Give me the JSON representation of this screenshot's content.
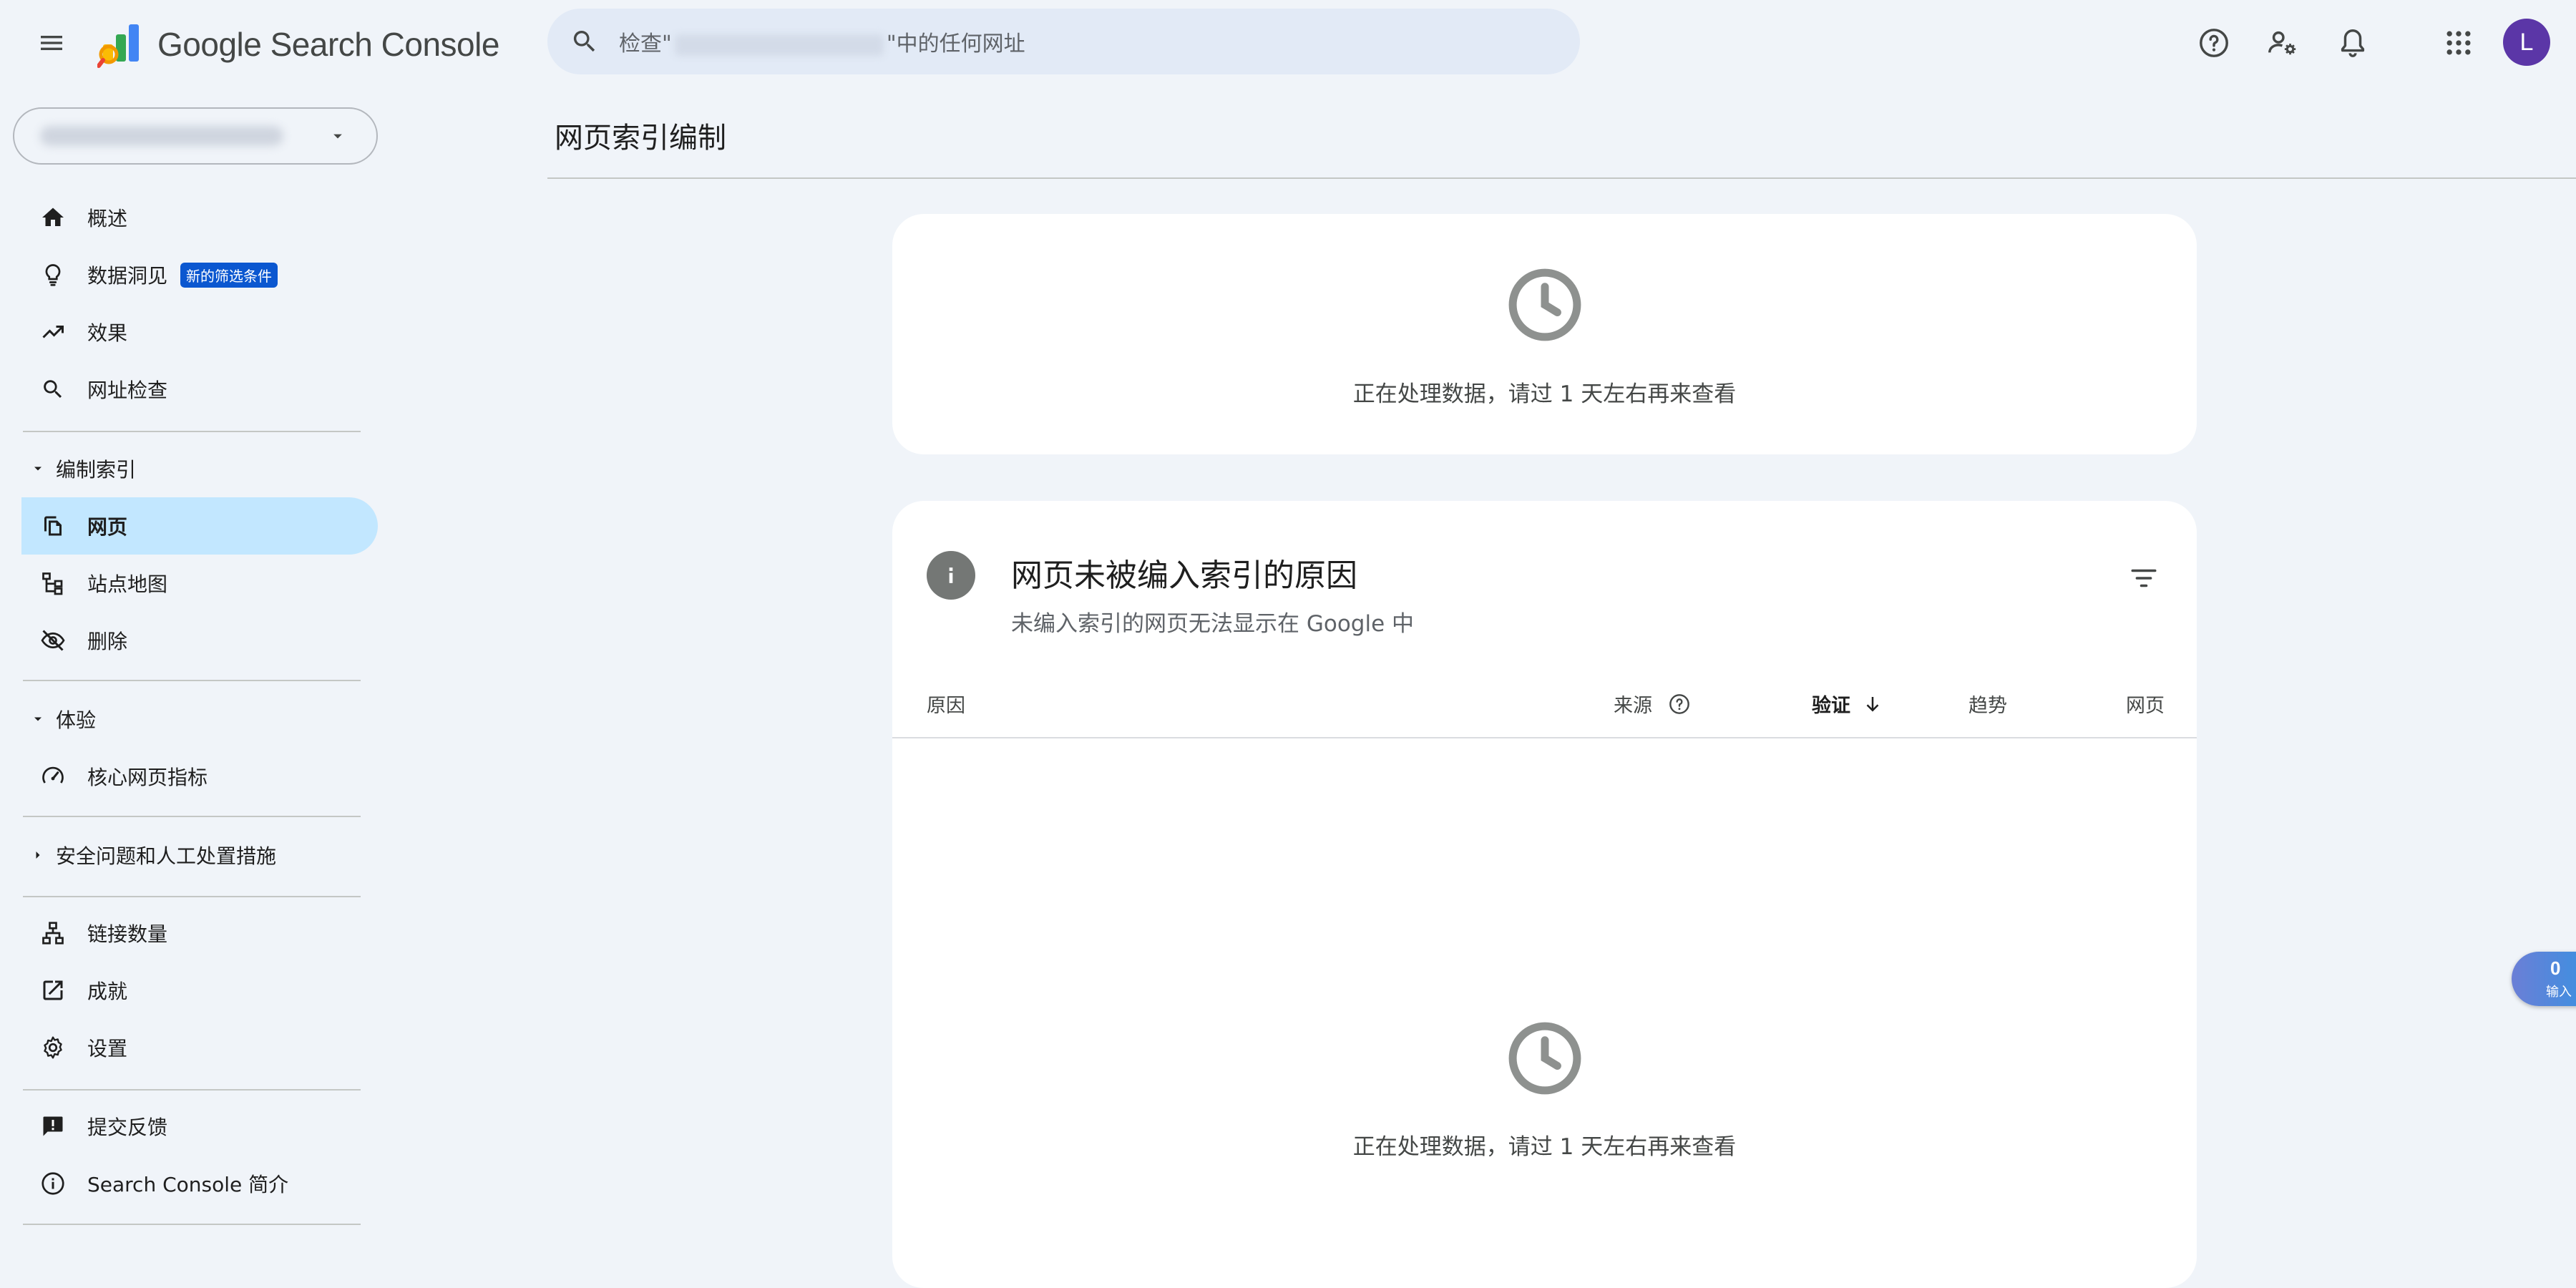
{
  "app": {
    "title": "Google Search Console",
    "brand_colors": {
      "blue": "#4285f4",
      "green": "#34a853",
      "yellow": "#fbbc04",
      "red": "#ea4335",
      "orange": "#f29900"
    }
  },
  "header": {
    "menu_icon": "menu-icon",
    "search": {
      "prefix": "检查",
      "suffix": "中的任何网址",
      "icon": "search-icon"
    },
    "icons": [
      "help-icon",
      "manage-accounts-icon",
      "notifications-icon",
      "apps-grid-icon"
    ],
    "avatar_letter": "L",
    "avatar_color": "#5b36a7"
  },
  "property_selector": {
    "icon": "dropdown-arrow-icon"
  },
  "sidebar": {
    "items_top": [
      {
        "label": "概述",
        "icon": "home-icon"
      },
      {
        "label": "数据洞见",
        "icon": "lightbulb-icon",
        "badge": "新的筛选条件"
      },
      {
        "label": "效果",
        "icon": "trending-up-icon"
      },
      {
        "label": "网址检查",
        "icon": "search-icon"
      }
    ],
    "index_section": {
      "label": "编制索引",
      "items": [
        {
          "label": "网页",
          "icon": "pages-icon",
          "active": true
        },
        {
          "label": "站点地图",
          "icon": "sitemap-icon"
        },
        {
          "label": "删除",
          "icon": "visibility-off-icon"
        }
      ]
    },
    "experience_section": {
      "label": "体验",
      "items": [
        {
          "label": "核心网页指标",
          "icon": "speed-icon"
        }
      ]
    },
    "security_section": {
      "label": "安全问题和人工处置措施"
    },
    "links_items": [
      {
        "label": "链接数量",
        "icon": "links-icon"
      },
      {
        "label": "成就",
        "icon": "open-in-new-icon"
      },
      {
        "label": "设置",
        "icon": "settings-icon"
      }
    ],
    "footer_items": [
      {
        "label": "提交反馈",
        "icon": "feedback-icon"
      },
      {
        "label": "Search Console 简介",
        "icon": "info-icon"
      }
    ],
    "active_color": "#c2e7ff"
  },
  "main": {
    "page_title": "网页索引编制",
    "processing_card": {
      "message": "正在处理数据，请过 1 天左右再来查看",
      "icon": "clock-icon"
    },
    "reasons_card": {
      "title": "网页未被编入索引的原因",
      "subtitle": "未编入索引的网页无法显示在 Google 中",
      "columns": [
        "原因",
        "来源",
        "验证",
        "趋势",
        "网页"
      ],
      "sorted_column": "验证",
      "empty_message": "正在处理数据，请过 1 天左右再来查看",
      "icons": [
        "info-icon",
        "filter-icon",
        "help-icon",
        "arrow-down-icon",
        "clock-icon"
      ]
    }
  },
  "floating_widget": {
    "count": "0",
    "label": "输入"
  }
}
